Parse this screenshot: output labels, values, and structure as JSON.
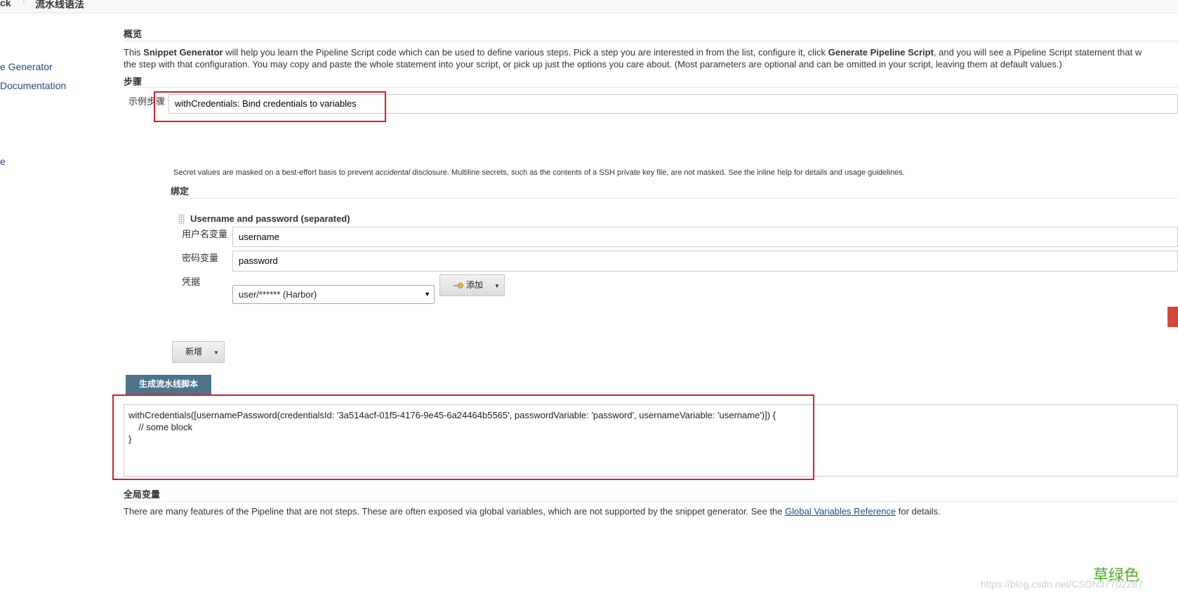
{
  "breadcrumb": {
    "item_back": "ck",
    "item_current": "流水线语法"
  },
  "sidebar": {
    "items": [
      {
        "label": "e Generator"
      },
      {
        "label": "Documentation"
      },
      {
        "label": "e"
      }
    ]
  },
  "overview": {
    "title": "概览",
    "text_parts": [
      "This ",
      "Snippet Generator",
      " will help you learn the Pipeline Script code which can be used to define various steps. Pick a step you are interested in from the list, configure it, click ",
      "Generate Pipeline Script",
      ", and you will see a Pipeline Script statement that w"
    ],
    "line2": "the step with that configuration. You may copy and paste the whole statement into your script, or pick up just the options you care about. (Most parameters are optional and can be omitted in your script, leaving them at default values.)"
  },
  "steps": {
    "title": "步骤",
    "sample_step_label": "示例步骤",
    "sample_step_value": "withCredentials: Bind credentials to variables"
  },
  "secret_note": {
    "before": "Secret values are masked on a best-effort basis to prevent ",
    "italic": "accidental",
    "after": " disclosure. Multiline secrets, such as the contents of a SSH private key file, are not masked. See the inline help for details and usage guidelines."
  },
  "bindings": {
    "title": "绑定",
    "binding_title": "Username and password (separated)",
    "username_label": "用户名变量",
    "username_value": "username",
    "password_label": "密码变量",
    "password_value": "password",
    "credentials_label": "凭据",
    "credentials_selected": "user/****** (Harbor)",
    "add_label": "添加",
    "new_label": "新增"
  },
  "generate_button": "生成流水线脚本",
  "output": {
    "lines": [
      "withCredentials([usernamePassword(credentialsId: '3a514acf-01f5-4176-9e45-6a24464b5565', passwordVariable: 'password', usernameVariable: 'username')]) {",
      "    // some block",
      "}"
    ]
  },
  "global_vars": {
    "title": "全局变量",
    "text_before": "There are many features of the Pipeline that are not steps. These are often exposed via global variables, which are not supported by the snippet generator. See the ",
    "link": "Global Variables Reference",
    "text_after": " for details."
  },
  "watermark": {
    "annotation": "草绿色",
    "url": "https://blog.csdn.net/CSDN37702287"
  },
  "colors": {
    "accent": "#4b758b",
    "link": "#204a87",
    "highlight": "#e01b24",
    "annotation": "#4caf1f"
  }
}
